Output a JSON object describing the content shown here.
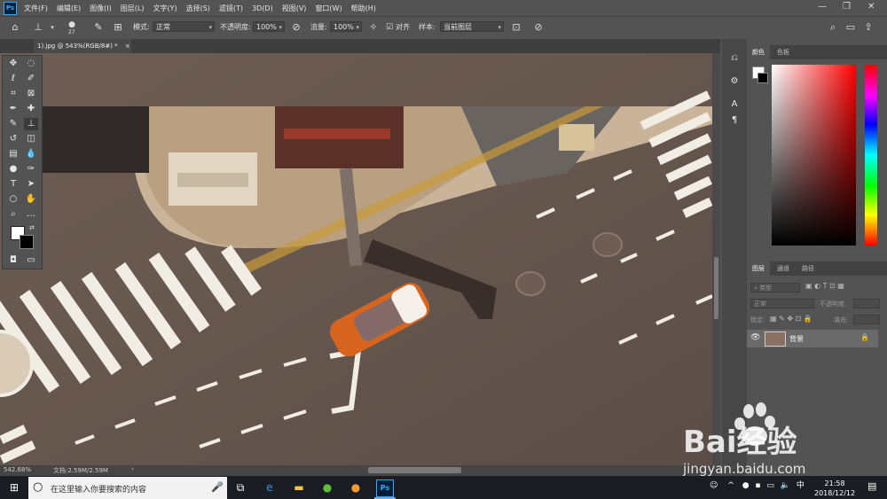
{
  "menubar": {
    "logo": "Ps",
    "items": [
      "文件(F)",
      "编辑(E)",
      "图像(I)",
      "图层(L)",
      "文字(Y)",
      "选择(S)",
      "滤镜(T)",
      "3D(D)",
      "视图(V)",
      "窗口(W)",
      "帮助(H)"
    ]
  },
  "optionsbar": {
    "brush_size": "27",
    "mode_label": "模式:",
    "mode_value": "正常",
    "opacity_label": "不透明度:",
    "opacity_value": "100%",
    "flow_label": "流量:",
    "flow_value": "100%",
    "align_label": "对齐",
    "sample_label": "样本:",
    "sample_value": "当前图层"
  },
  "document": {
    "tab_title": "1).jpg @ 543%(RGB/8#) *"
  },
  "statusbar": {
    "zoom": "542.68%",
    "doc_info": "文档:2.59M/2.59M"
  },
  "color_panel": {
    "tabs": [
      "颜色",
      "色板"
    ],
    "active_tab": 0
  },
  "layers_panel": {
    "tabs": [
      "图层",
      "通道",
      "路径"
    ],
    "active_tab": 0,
    "kind_filter": "类型",
    "blend_mode": "正常",
    "opacity_label": "不透明度:",
    "lock_label": "锁定:",
    "fill_label": "填充:",
    "layers": [
      {
        "name": "背景",
        "visible": true,
        "locked": true
      }
    ]
  },
  "taskbar": {
    "search_placeholder": "在这里输入你要搜索的内容",
    "ime": "中",
    "time": "21:58",
    "date": "2018/12/12"
  },
  "watermark": {
    "text": "Bai经验",
    "url": "jingyan.baidu.com"
  },
  "colors": {
    "ui_bg": "#535353",
    "ps_blue": "#31a8ff",
    "taskbar": "#1a1e24"
  }
}
